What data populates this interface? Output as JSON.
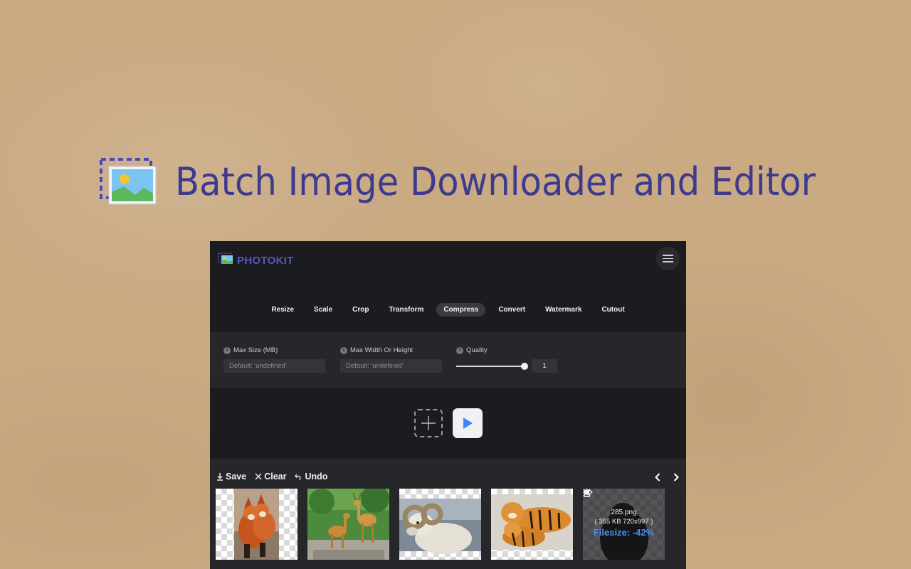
{
  "hero": {
    "title": "Batch Image Downloader and  Editor",
    "icon": "image-gallery-icon"
  },
  "app": {
    "brand": "PHOTOKIT",
    "brand_color": "#5a55c4",
    "tabs": [
      {
        "label": "Resize",
        "active": false
      },
      {
        "label": "Scale",
        "active": false
      },
      {
        "label": "Crop",
        "active": false
      },
      {
        "label": "Transform",
        "active": false
      },
      {
        "label": "Compress",
        "active": true
      },
      {
        "label": "Convert",
        "active": false
      },
      {
        "label": "Watermark",
        "active": false
      },
      {
        "label": "Cutout",
        "active": false
      }
    ],
    "options": {
      "max_size": {
        "label": "Max Size (MB)",
        "placeholder": "Default: 'undefined'"
      },
      "max_dim": {
        "label": "Max Width Or Height",
        "placeholder": "Default: 'undefined'"
      },
      "quality": {
        "label": "Quality",
        "value": "1",
        "level": 1.0
      }
    },
    "toolbar": {
      "save_label": "Save",
      "clear_label": "Clear",
      "undo_label": "Undo"
    },
    "thumbnails": [
      {
        "subject": "fox-pair"
      },
      {
        "subject": "deer-statues"
      },
      {
        "subject": "ram"
      },
      {
        "subject": "tigers"
      },
      {
        "subject": "hovered-image",
        "file_name": "285.png",
        "meta": "( 355 KB 720x997 )",
        "filesize": "Filesize: -42%"
      }
    ],
    "accent_color": "#4b8ef7"
  }
}
